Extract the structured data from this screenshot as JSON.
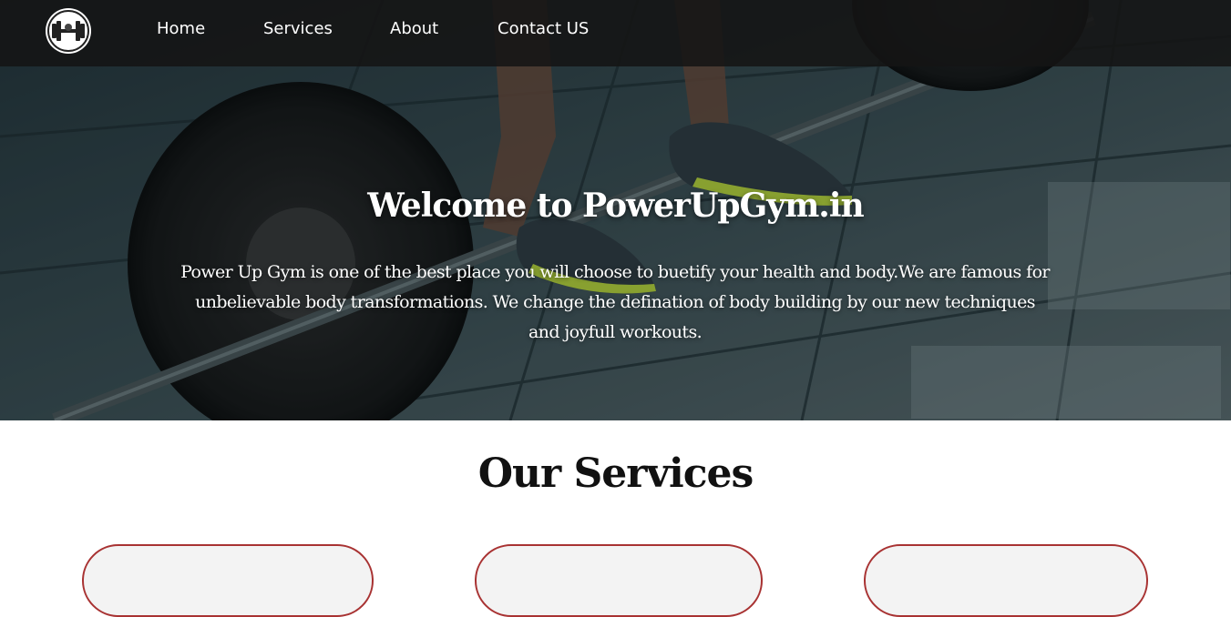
{
  "navbar": {
    "logo_icon": "dumbbell-icon",
    "links": [
      {
        "label": "Home"
      },
      {
        "label": "Services"
      },
      {
        "label": "About"
      },
      {
        "label": "Contact US"
      }
    ]
  },
  "hero": {
    "title": "Welcome to PowerUpGym.in",
    "description": "Power Up Gym is one of the best place you will choose to buetify your health and body.We are famous for unbelievable body transformations. We change the defination of body building by our new techniques and joyfull workouts."
  },
  "services": {
    "title": "Our Services",
    "card_border_color": "#a83232"
  }
}
